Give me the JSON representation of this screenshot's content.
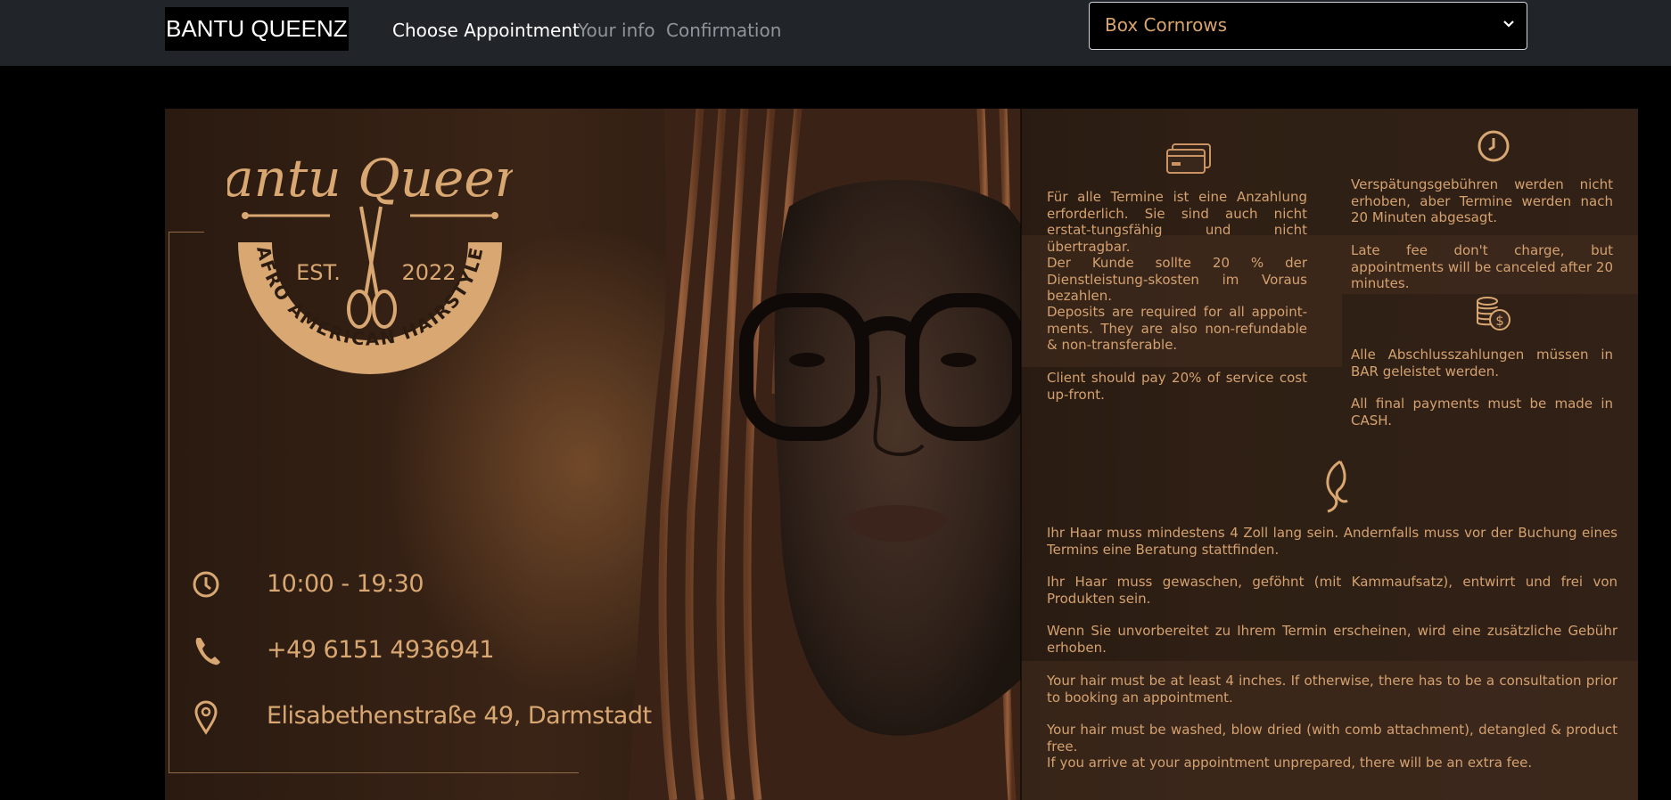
{
  "navbar": {
    "brand": "BANTU QUEENZ",
    "links": [
      {
        "label": "Choose Appointment",
        "active": true
      },
      {
        "label": "Your info",
        "active": false
      },
      {
        "label": "Confirmation",
        "active": false
      }
    ],
    "service_select": {
      "value": "Box Cornrows"
    }
  },
  "banner": {
    "logo": {
      "name": "Bantu Queenz",
      "est": "EST.",
      "year": "2022",
      "tagline": "AFRO AMERICAN HAIRSTYLE"
    },
    "contact": {
      "hours": "10:00 - 19:30",
      "phone": "+49 6151 4936941",
      "address": "Elisabethenstraße 49, Darmstadt"
    },
    "policies": {
      "deposit_de": "Für alle Termine ist eine Anzahlung erforderlich. Sie sind auch nicht erstat-tungsfähig und nicht übertragbar.",
      "upfront_de": "Der Kunde sollte 20 % der Dienstleistung-skosten im Voraus bezahlen.",
      "deposit_en": "Deposits are required for all appoint-ments. They are also non-refundable & non-transferable.",
      "upfront_en": "Client should pay 20% of service cost up-front.",
      "late_de": "Verspätungsgebühren werden nicht erhoben, aber Termine werden nach 20 Minuten abgesagt.",
      "late_en": "Late fee don't charge, but appointments will be canceled after 20 minutes.",
      "cash_de": "Alle Abschlusszahlungen müssen in BAR geleistet werden.",
      "cash_en": "All final payments must be made in CASH.",
      "hair_length_de": "Ihr Haar muss mindestens 4 Zoll lang sein. Andernfalls muss vor der Buchung eines Termins eine Beratung stattfinden.",
      "hair_prep_de": "Ihr Haar muss gewaschen, geföhnt (mit Kammaufsatz), entwirrt und frei von Produkten sein.",
      "unprepared_de": "Wenn Sie unvorbereitet zu Ihrem Termin erscheinen, wird eine zusätzliche Gebühr erhoben.",
      "hair_length_en": "Your hair must be at least 4 inches. If otherwise, there has to be a consultation prior to booking an appointment.",
      "hair_prep_en": "Your hair must be washed, blow dried (with comb attachment), detangled & product free.",
      "unprepared_en": "If you arrive at your appointment unprepared, there will be an extra fee."
    }
  },
  "colors": {
    "gold": "#d8a772",
    "navbar_bg": "#212529"
  }
}
